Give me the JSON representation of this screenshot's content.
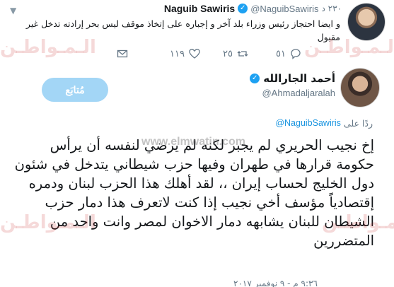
{
  "parent_tweet": {
    "display_name": "Naguib Sawiris",
    "handle": "@NaguibSawiris",
    "time": "٢٣٠ د",
    "text": "و ايضا احتجاز رئيس وزراء بلد آخر و إجباره على إتخاذ موقف ليس بحر إرادته تدخل غير مقبول",
    "reply_count": "٥١",
    "retweet_count": "٢٥",
    "like_count": "١١٩",
    "icons": [
      "verified-badge-icon",
      "chevron-down-icon",
      "reply-icon",
      "retweet-icon",
      "like-icon",
      "dm-icon"
    ]
  },
  "reply_tweet": {
    "display_name": "أحمد الجارالله",
    "handle": "@Ahmadaljaralah",
    "follow_label": "مُتابَع",
    "reply_prefix": "ردًا على",
    "reply_mention": "@NaguibSawiris",
    "text": "إخ نجيب الحريري لم يجبر لكنه لم يرضي لنفسه أن يرأس حكومة قرارها في طهران وفيها حزب شيطاني يتدخل في شئون دول الخليج لحساب إيران ،، لقد أهلك هذا الحزب لبنان ودمره إقتصادياً مؤسف أخي نجيب إذا كنت لاتعرف هذا دمار حزب الشيطان للبنان يشابهه دمار الاخوان لمصر  وانت واحد من المتضررين",
    "time": "٩:٣٦ م - ٩ نوفمبر ٢٠١٧"
  },
  "watermark": {
    "logo_text": "الـمـواطـن",
    "url": "www.elmwatin.com"
  },
  "colors": {
    "accent": "#1da1f2",
    "follow_button_bg": "#a3d6f6",
    "muted_text": "#657786",
    "mention": "#1b95e0"
  }
}
